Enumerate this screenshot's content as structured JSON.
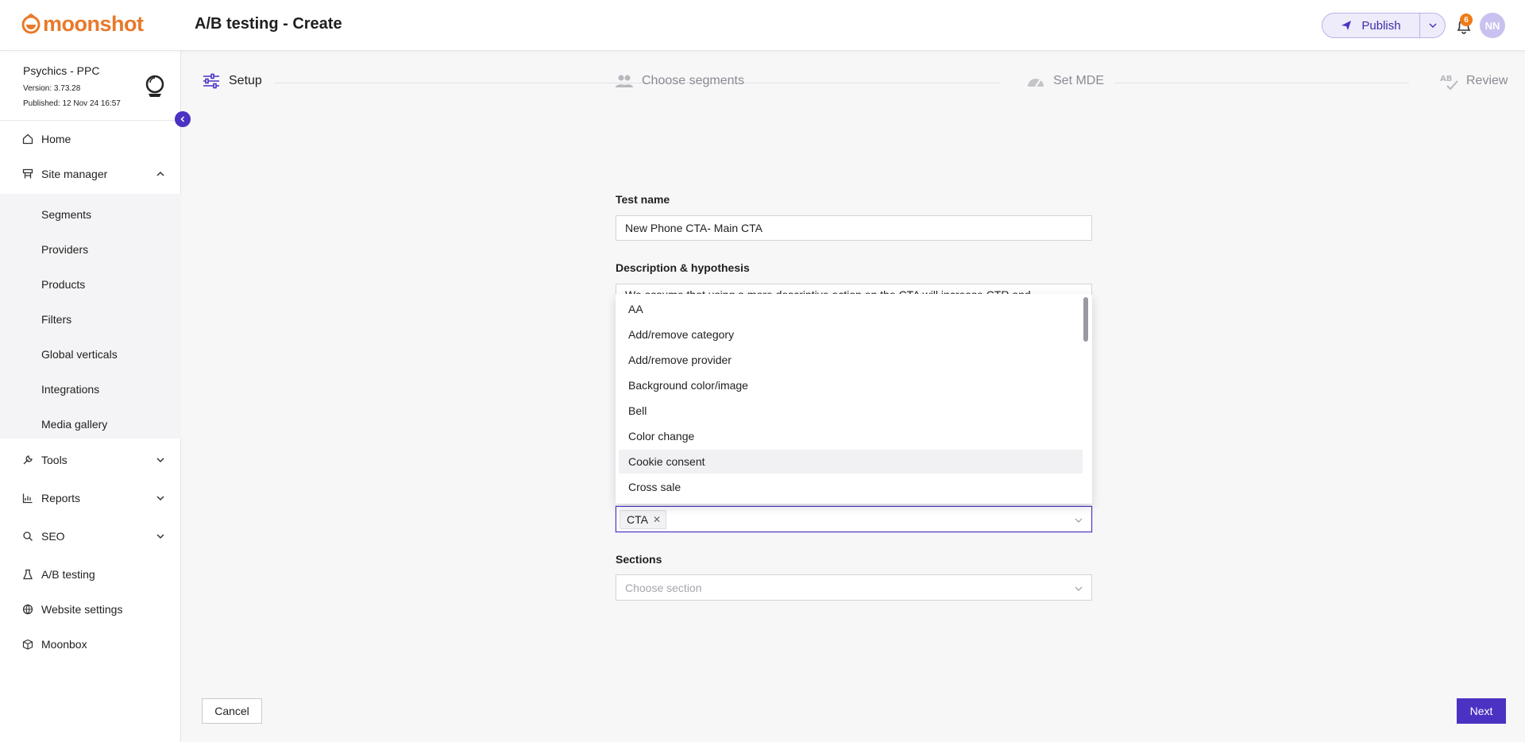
{
  "app": {
    "logo_text": "moonshot",
    "page_title": "A/B testing - Create"
  },
  "header": {
    "publish_label": "Publish",
    "notification_count": "6",
    "avatar_initials": "NN"
  },
  "site": {
    "name": "Psychics - PPC",
    "version": "Version: 3.73.28",
    "published": "Published: 12 Nov 24 16:57"
  },
  "sidebar": {
    "home": "Home",
    "site_manager": "Site manager",
    "sub_items": [
      "Segments",
      "Providers",
      "Products",
      "Filters",
      "Global verticals",
      "Integrations",
      "Media gallery"
    ],
    "tools": "Tools",
    "reports": "Reports",
    "seo": "SEO",
    "ab_testing": "A/B testing",
    "website_settings": "Website settings",
    "moonbox": "Moonbox"
  },
  "stepper": {
    "steps": [
      "Setup",
      "Choose segments",
      "Set MDE",
      "Review"
    ]
  },
  "form": {
    "test_name_label": "Test name",
    "test_name_value": "New Phone CTA- Main CTA",
    "description_label": "Description & hypothesis",
    "description_partial": "We assume that using a more descriptive action on the CTA will increase CTR and",
    "category_options": [
      "AA",
      "Add/remove category",
      "Add/remove provider",
      "Background color/image",
      "Bell",
      "Color change",
      "Cookie consent",
      "Cross sale"
    ],
    "selected_tag": "CTA",
    "sections_label": "Sections",
    "sections_placeholder": "Choose section"
  },
  "footer": {
    "cancel_label": "Cancel",
    "next_label": "Next"
  },
  "colors": {
    "accent": "#4b32c3",
    "brand": "#e8792a",
    "badge": "#f07a16"
  }
}
